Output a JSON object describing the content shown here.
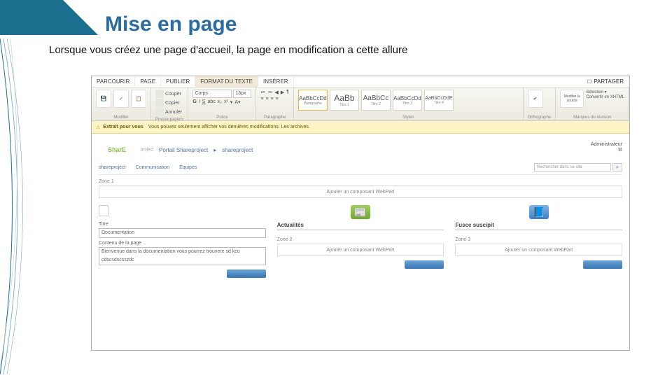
{
  "slide": {
    "title": "Mise en page",
    "body": "Lorsque vous créez une page d'accueil, la page en modification a cette allure"
  },
  "ribbon": {
    "tabs": [
      "PARCOURIR",
      "PAGE",
      "PUBLIER",
      "FORMAT DU TEXTE",
      "INSÉRER"
    ],
    "active_tab": "FORMAT DU TEXTE",
    "share": "PARTAGER",
    "groups": {
      "edit": {
        "label": "Modifier",
        "save": "Enregistrer",
        "checkin": "Archiver",
        "paste": "Coller"
      },
      "clipboard": {
        "label": "Presse-papiers",
        "cut": "Couper",
        "copy": "Copier",
        "undo": "Annuler"
      },
      "font": {
        "label": "Police",
        "family": "Corps",
        "size": "13px"
      },
      "paragraph": {
        "label": "Paragraphe"
      },
      "styles": {
        "label": "Styles",
        "items": [
          {
            "sample": "AaBbCcDd",
            "name": "Paragraphe"
          },
          {
            "sample": "AaBb",
            "name": "Titre 1"
          },
          {
            "sample": "AaBbCc",
            "name": "Titre 2"
          },
          {
            "sample": "AaBbCcDd",
            "name": "Titre 3"
          },
          {
            "sample": "AaBbCcDdE",
            "name": "Titre 4"
          }
        ]
      },
      "spell": {
        "label": "Orthographe",
        "btn": "Orthographe"
      },
      "markup": {
        "label": "Marques de révision",
        "src": "Modifier la source",
        "sel": "Sélection ▾",
        "conv": "Convertir en XHTML"
      }
    }
  },
  "notif": {
    "bold": "Extrait pour vous",
    "text": "Vous pouvez seulement afficher vos dernières modifications. Les archives."
  },
  "breadcrumb": {
    "logo": "Shar",
    "logo2": "E",
    "sub": "project",
    "portal": "Portail Shareproject",
    "site": "shareproject"
  },
  "user": "Administrateur",
  "nav": {
    "items": [
      "shareproject",
      "Communication",
      "Équipes"
    ],
    "search_ph": "Rechercher dans ce site",
    "search_icon": "⌕"
  },
  "zones": {
    "z1": "Zone 1",
    "z1_add": "Ajouter un composant WebPart",
    "z2": "Zone 2",
    "z2_add": "Ajouter un composant WebPart",
    "z3": "Zone 3",
    "z3_add": "Ajouter un composant WebPart"
  },
  "col_left": {
    "title": "Titre",
    "title_val": "Documentation",
    "content_lbl": "Contenu de la page",
    "content_val": "Bienvenue dans la documentation vous pourrez trouvere sd kco cdscsdscsszdc"
  },
  "col_mid": {
    "title": "Actualités"
  },
  "col_right": {
    "title": "Fusce suscipit"
  }
}
